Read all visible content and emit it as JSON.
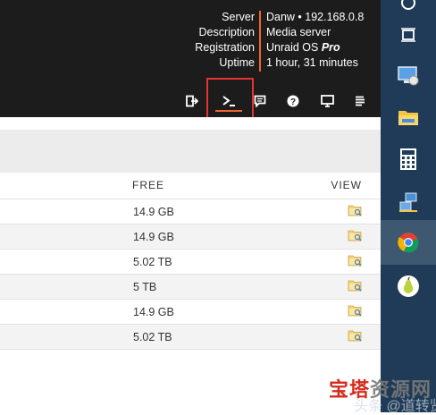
{
  "server_info": {
    "labels": [
      "Server",
      "Description",
      "Registration",
      "Uptime"
    ],
    "server": "Danw • 192.168.0.8",
    "description": "Media server",
    "registration_main": "Unraid OS ",
    "registration_edition": "Pro",
    "uptime": "1 hour, 31 minutes"
  },
  "toolbar": {
    "icons": [
      "logout-icon",
      "terminal-icon",
      "feedback-icon",
      "help-icon",
      "monitor-icon",
      "log-icon"
    ]
  },
  "table": {
    "columns": {
      "free": "FREE",
      "view": "VIEW"
    },
    "rows": [
      {
        "free": "14.9 GB"
      },
      {
        "free": "14.9 GB"
      },
      {
        "free": "5.02 TB"
      },
      {
        "free": "5 TB"
      },
      {
        "free": "14.9 GB"
      },
      {
        "free": "5.02 TB"
      }
    ]
  },
  "taskbar": {
    "icons": [
      "power-icon",
      "task-view-icon",
      "network-monitor-icon",
      "file-explorer-icon",
      "calculator-icon",
      "network-share-icon",
      "chrome-icon",
      "pear-app-icon"
    ]
  },
  "colors": {
    "accent": "#f0652e",
    "header_bg": "#1c1c1c",
    "taskbar_bg": "#1f3b57",
    "highlight": "#e63232"
  },
  "watermark": {
    "text_red": "宝塔",
    "text_gray": "资源网",
    "sub": "头条 @道转贤"
  }
}
